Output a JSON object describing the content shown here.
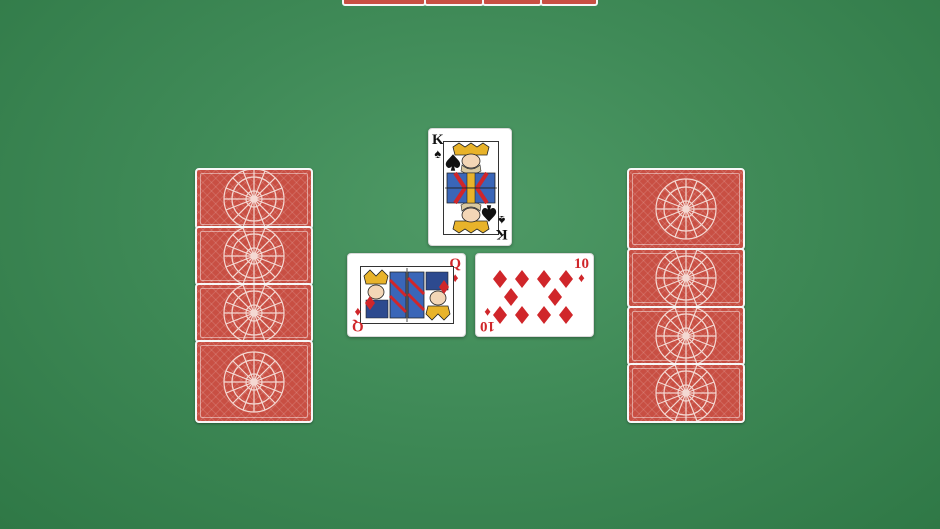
{
  "table": {
    "felt_color": "#3f8a57",
    "card_back_color": "#c84f43"
  },
  "opponent_top": {
    "cards_visible": 4
  },
  "opponent_left": {
    "card_count": 4
  },
  "opponent_right": {
    "card_count": 4
  },
  "trick": {
    "north": {
      "rank": "K",
      "suit_symbol": "♠",
      "suit": "spades",
      "color": "black"
    },
    "west": {
      "rank": "Q",
      "suit_symbol": "♦",
      "suit": "diamonds",
      "color": "red"
    },
    "east": {
      "rank": "10",
      "suit_symbol": "♦",
      "suit": "diamonds",
      "color": "red"
    }
  }
}
